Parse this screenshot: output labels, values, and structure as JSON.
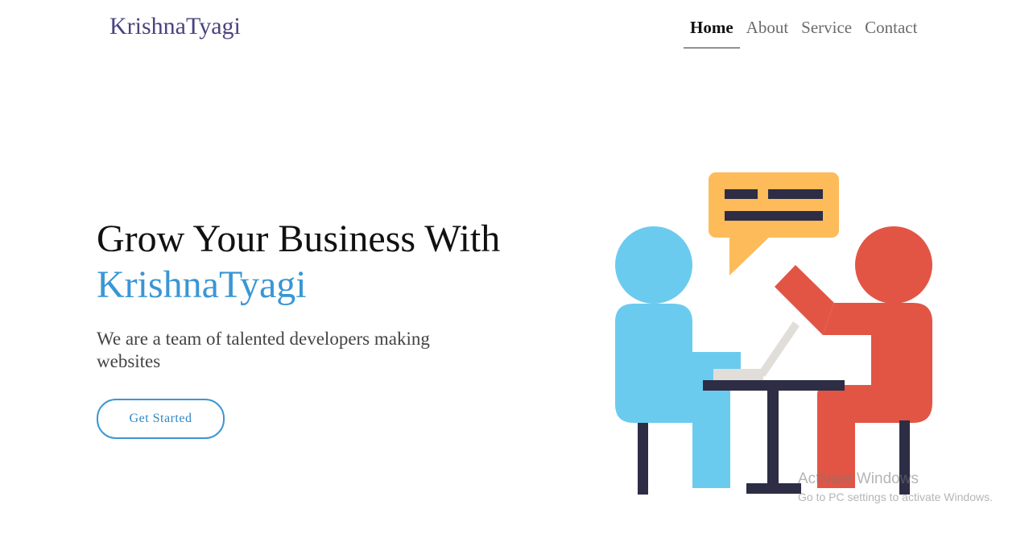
{
  "header": {
    "brand": "KrishnaTyagi",
    "nav": [
      {
        "label": "Home",
        "active": true
      },
      {
        "label": "About",
        "active": false
      },
      {
        "label": "Service",
        "active": false
      },
      {
        "label": "Contact",
        "active": false
      }
    ]
  },
  "hero": {
    "title_line1": "Grow Your Business With",
    "title_line2": "KrishnaTyagi",
    "subtitle": "We are a team of talented developers making websites",
    "cta_label": "Get Started"
  },
  "illustration": {
    "icon": "meeting-illustration-icon",
    "colors": {
      "left_person": "#6bcbef",
      "right_person": "#e25545",
      "speech_bubble": "#fdbb5a",
      "furniture": "#2d2d46",
      "laptop": "#e1deda"
    }
  },
  "watermark": {
    "line1": "Activate Windows",
    "line2": "Go to PC settings to activate Windows."
  },
  "colors": {
    "brand": "#4a4380",
    "accent": "#3a96d4"
  }
}
